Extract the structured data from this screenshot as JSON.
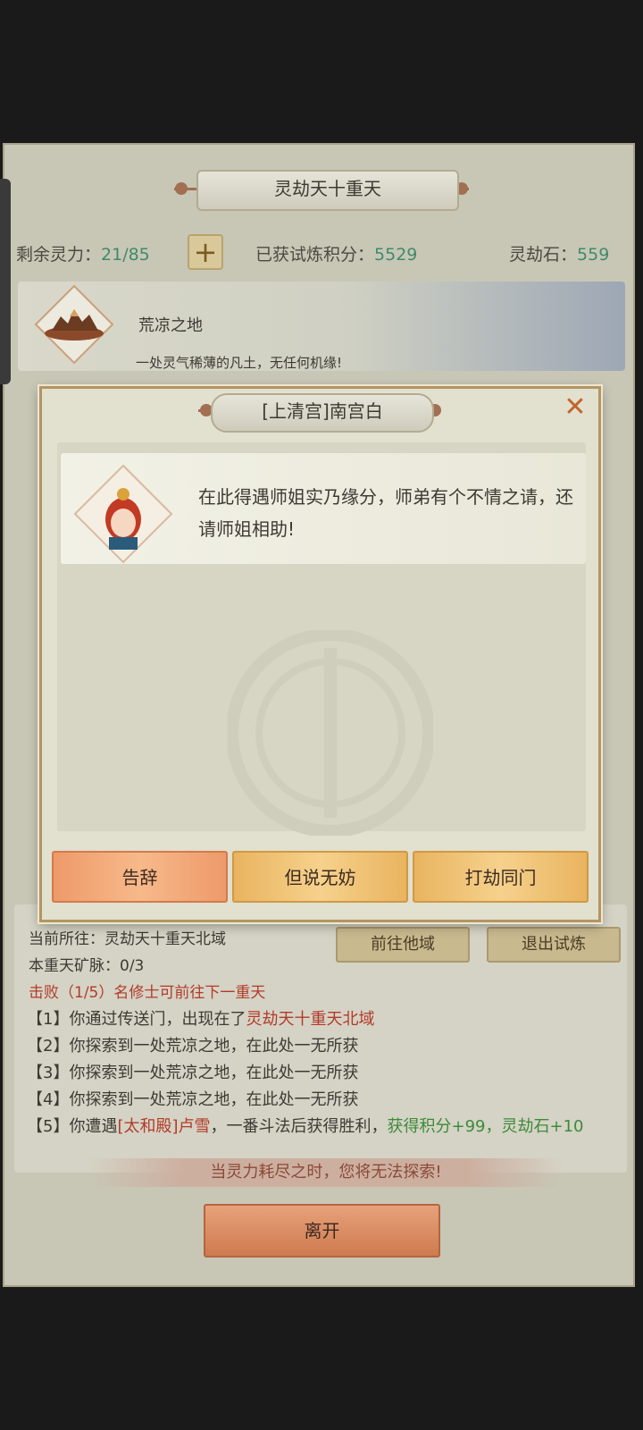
{
  "header": {
    "title": "灵劫天十重天"
  },
  "stats": {
    "spirit_label": "剩余灵力：",
    "spirit_value": "21/85",
    "score_label": "已获试炼积分：",
    "score_value": "5529",
    "stone_label": "灵劫石：",
    "stone_value": "559"
  },
  "location": {
    "name": "荒凉之地",
    "description": "一处灵气稀薄的凡土，无任何机缘!"
  },
  "dialog": {
    "title": "[上清宫]南宫白",
    "message": "在此得遇师姐实乃缘分，师弟有个不情之请，还请师姐相助!",
    "choices": [
      "告辞",
      "但说无妨",
      "打劫同门"
    ]
  },
  "info": {
    "current_location": "当前所往：灵劫天十重天北域",
    "ore_veins": "本重天矿脉：0/3",
    "defeat_prefix": "击败（",
    "defeat_count": "1/5",
    "defeat_suffix": "）名修士可前往下一重天"
  },
  "buttons": {
    "go_other": "前往他域",
    "exit_trial": "退出试炼",
    "leave": "离开"
  },
  "log": [
    {
      "prefix": "【1】你通过传送门，出现在了",
      "highlight": "灵劫天十重天北域"
    },
    {
      "text": "【2】你探索到一处荒凉之地，在此处一无所获"
    },
    {
      "text": "【3】你探索到一处荒凉之地，在此处一无所获"
    },
    {
      "text": "【4】你探索到一处荒凉之地，在此处一无所获"
    },
    {
      "prefix": "【5】你遭遇",
      "red": "[太和殿]卢雪",
      "middle": "，一番斗法后获得胜利，",
      "green": "获得积分+99，灵劫石+10"
    }
  ],
  "warning": "当灵力耗尽之时，您将无法探索!",
  "colors": {
    "accent_green": "#3f8a6b",
    "accent_red": "#b23b2a",
    "button_orange": "#e88a5a",
    "button_gold": "#e8b85a"
  }
}
